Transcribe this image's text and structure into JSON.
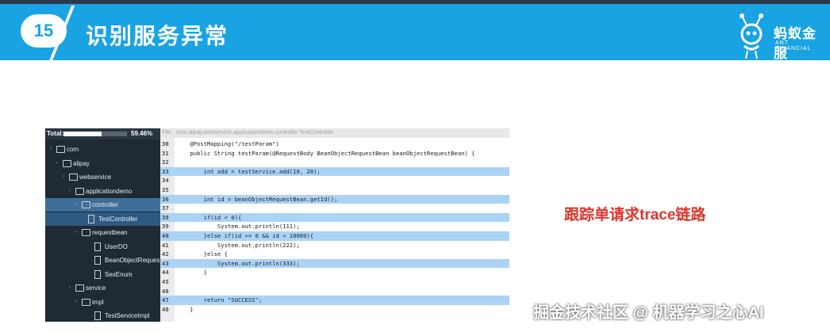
{
  "slide": {
    "number": "15",
    "title": "识别服务异常",
    "logo_text": "蚂蚁金服",
    "logo_sub": "ANT FINANCIAL"
  },
  "coverage": {
    "label": "Total:",
    "percent_text": "59.46%",
    "fraction": 0.5946
  },
  "tree": [
    {
      "label": "com",
      "kind": "folder"
    },
    {
      "label": "alipay",
      "kind": "folder"
    },
    {
      "label": "webservice",
      "kind": "folder"
    },
    {
      "label": "applicationdemo",
      "kind": "folder"
    },
    {
      "label": "controller",
      "kind": "folder"
    },
    {
      "label": "TestController",
      "kind": "file"
    },
    {
      "label": "requestbean",
      "kind": "folder"
    },
    {
      "label": "UserDO",
      "kind": "file"
    },
    {
      "label": "BeanObjectRequestBean",
      "kind": "file"
    },
    {
      "label": "SexEnum",
      "kind": "file"
    },
    {
      "label": "service",
      "kind": "folder"
    },
    {
      "label": "impl",
      "kind": "folder"
    },
    {
      "label": "TestServiceImpl",
      "kind": "file"
    }
  ],
  "editor": {
    "file_label": "File:",
    "file_path": "com.alipay.webservice.applicationdemo.controller.TestController",
    "lines": [
      {
        "no": "30",
        "text": "    @PostMapping(\"/testParam\")",
        "hl": false
      },
      {
        "no": "31",
        "text": "    public String testParam(@RequestBody BeanObjectRequestBean beanObjectRequestBean) {",
        "hl": false
      },
      {
        "no": "32",
        "text": "",
        "hl": false
      },
      {
        "no": "33",
        "text": "        int add = testService.add(10, 20);",
        "hl": true
      },
      {
        "no": "34",
        "text": "",
        "hl": false
      },
      {
        "no": "35",
        "text": "",
        "hl": false
      },
      {
        "no": "36",
        "text": "        int id = beanObjectRequestBean.getId();",
        "hl": true
      },
      {
        "no": "37",
        "text": "",
        "hl": false
      },
      {
        "no": "38",
        "text": "        if(id < 0){",
        "hl": true
      },
      {
        "no": "39",
        "text": "            System.out.println(111);",
        "hl": false
      },
      {
        "no": "40",
        "text": "        }else if(id >= 0 && id < 10000){",
        "hl": true
      },
      {
        "no": "41",
        "text": "            System.out.println(222);",
        "hl": false
      },
      {
        "no": "42",
        "text": "        }else {",
        "hl": false
      },
      {
        "no": "43",
        "text": "            System.out.println(333);",
        "hl": true
      },
      {
        "no": "44",
        "text": "        }",
        "hl": false
      },
      {
        "no": "45",
        "text": "",
        "hl": false
      },
      {
        "no": "46",
        "text": "",
        "hl": false
      },
      {
        "no": "47",
        "text": "        return \"SUCCESS\";",
        "hl": true
      },
      {
        "no": "48",
        "text": "    }",
        "hl": false
      }
    ]
  },
  "caption": "跟踪单请求trace链路",
  "watermark": "掘金技术社区 @ 机器学习之心AI",
  "colors": {
    "header": "#1aa3e3",
    "sidebar": "#1f2a33",
    "highlight": "#aad3f5",
    "caption": "#e0342d"
  }
}
